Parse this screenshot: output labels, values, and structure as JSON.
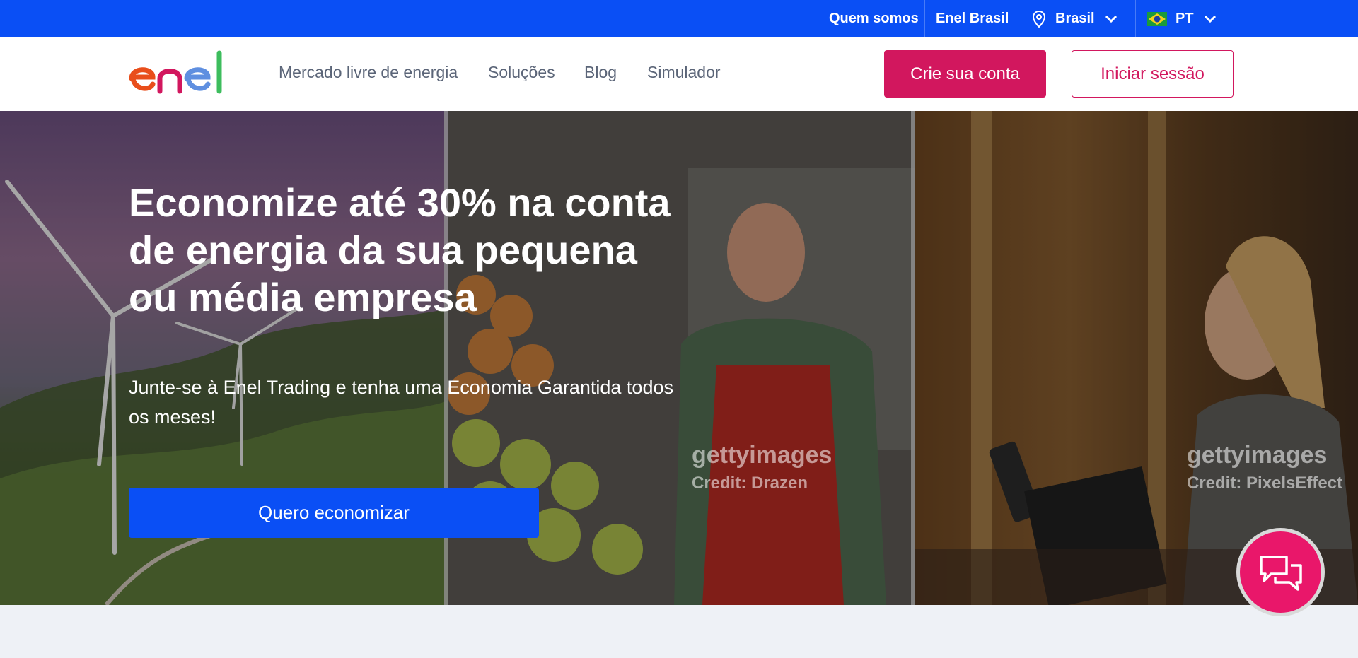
{
  "topbar": {
    "links": [
      "Quem somos",
      "Enel Brasil"
    ],
    "country": "Brasil",
    "language": "PT",
    "flag_icon": "brazil-flag-icon"
  },
  "brand": {
    "logo_text": "enel"
  },
  "nav": {
    "items": [
      "Mercado livre de energia",
      "Soluções",
      "Blog",
      "Simulador"
    ]
  },
  "actions": {
    "create_account": "Crie sua conta",
    "sign_in": "Iniciar sessão"
  },
  "hero": {
    "title": "Economize até 30% na conta de energia da sua pequena ou média empresa",
    "subtitle": "Junte-se à Enel Trading e tenha uma Economia Garantida todos os meses!",
    "cta": "Quero economizar",
    "watermarks": [
      {
        "logo": "gettyimages",
        "credit": "Credit: Drazen_"
      },
      {
        "logo": "gettyimages",
        "credit": "Credit: PixelsEffect"
      }
    ]
  },
  "colors": {
    "topbar": "#0a4ff5",
    "brand_pink": "#d2175e",
    "cta_blue": "#0a4ff5",
    "chat": "#e9176a"
  },
  "chat": {
    "icon": "chat-bubbles-icon"
  }
}
